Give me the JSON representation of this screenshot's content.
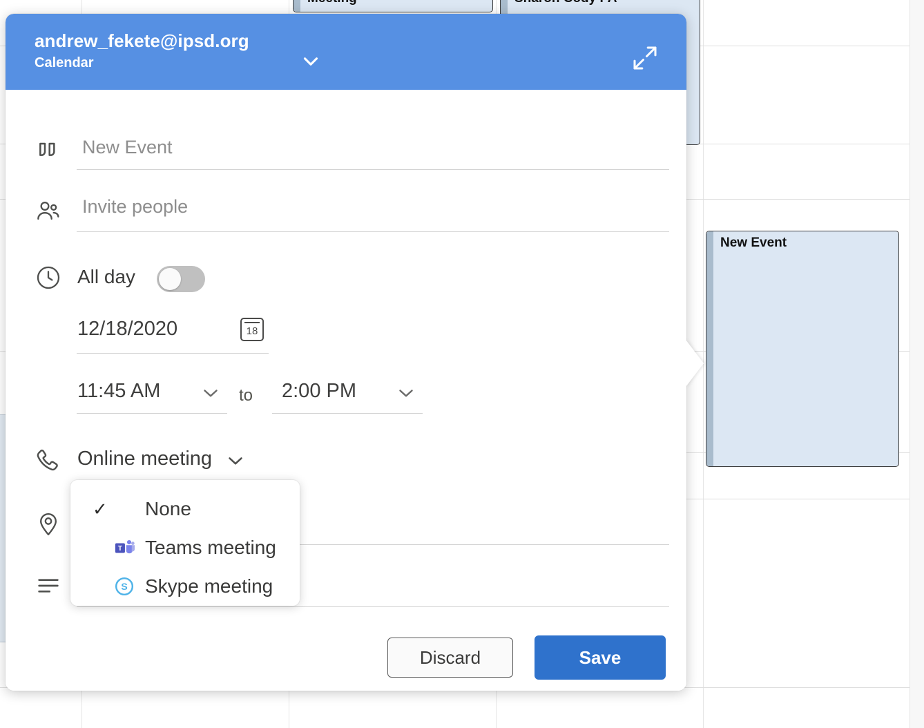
{
  "background_calendar": {
    "events": [
      {
        "title": "Meeting",
        "icon": "calendar-event"
      },
      {
        "title": "Sharon Cody PA",
        "icon": "calendar-event"
      },
      {
        "title": "New Event",
        "icon": "calendar-event"
      }
    ]
  },
  "popup": {
    "header": {
      "account": "andrew_fekete@ipsd.org",
      "module": "Calendar",
      "chevron_icon": "chevron-down-icon",
      "expand_icon": "expand-diagonal-icon",
      "background_color": "#5690e3"
    },
    "fields": {
      "title": {
        "icon": "quote-icon",
        "placeholder": "New Event",
        "value": ""
      },
      "people": {
        "icon": "people-icon",
        "placeholder": "Invite people",
        "value": ""
      },
      "allday": {
        "icon": "clock-icon",
        "label": "All day",
        "toggle_state": "off"
      },
      "date": {
        "value": "12/18/2020",
        "picker_icon": "calendar-icon",
        "picker_day": "18"
      },
      "time": {
        "start": "11:45 AM",
        "separator": "to",
        "end": "2:00 PM",
        "start_chevron_icon": "chevron-down-icon",
        "end_chevron_icon": "chevron-down-icon"
      },
      "online_meeting": {
        "icon": "phone-icon",
        "label": "Online meeting",
        "chevron_icon": "chevron-down-icon"
      },
      "location": {
        "icon": "location-pin-icon",
        "placeholder": "",
        "value": ""
      },
      "description": {
        "icon": "description-lines-icon",
        "placeholder": "",
        "value": ""
      }
    },
    "dropdown": {
      "open": true,
      "options": [
        {
          "label": "None",
          "icon": "check-icon",
          "selected": true,
          "glyph": "✓"
        },
        {
          "label": "Teams meeting",
          "icon": "teams-icon",
          "selected": false,
          "glyph": ""
        },
        {
          "label": "Skype meeting",
          "icon": "skype-icon",
          "selected": false,
          "glyph": ""
        }
      ]
    },
    "actions": {
      "discard_label": "Discard",
      "save_label": "Save",
      "save_color": "#2f72cc"
    }
  }
}
